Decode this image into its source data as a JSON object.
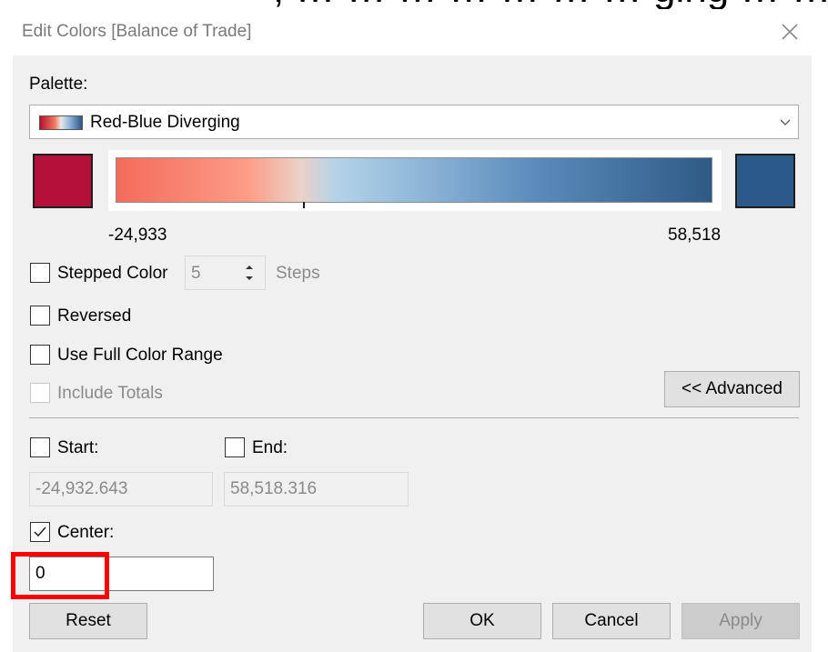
{
  "window": {
    "title": "Edit Colors [Balance of Trade]",
    "top_cut_text": ", … … … … … … … ging … … p"
  },
  "palette": {
    "label": "Palette:",
    "selected": "Red-Blue Diverging",
    "icon": "chevron-down-icon"
  },
  "colors": {
    "start": "#b5103a",
    "end": "#2b5a8a"
  },
  "range": {
    "min_label": "-24,933",
    "max_label": "58,518"
  },
  "stepped": {
    "label": "Stepped Color",
    "checked": false,
    "steps_value": "5",
    "steps_label": "Steps"
  },
  "options": {
    "reversed": "Reversed",
    "full_range": "Use Full Color Range",
    "include_totals": "Include Totals"
  },
  "advanced_button": "<< Advanced",
  "start": {
    "label": "Start:",
    "value": "-24,932.643"
  },
  "end": {
    "label": "End:",
    "value": "58,518.316"
  },
  "center": {
    "label": "Center:",
    "checked": true,
    "value": "0"
  },
  "buttons": {
    "reset": "Reset",
    "ok": "OK",
    "cancel": "Cancel",
    "apply": "Apply"
  }
}
